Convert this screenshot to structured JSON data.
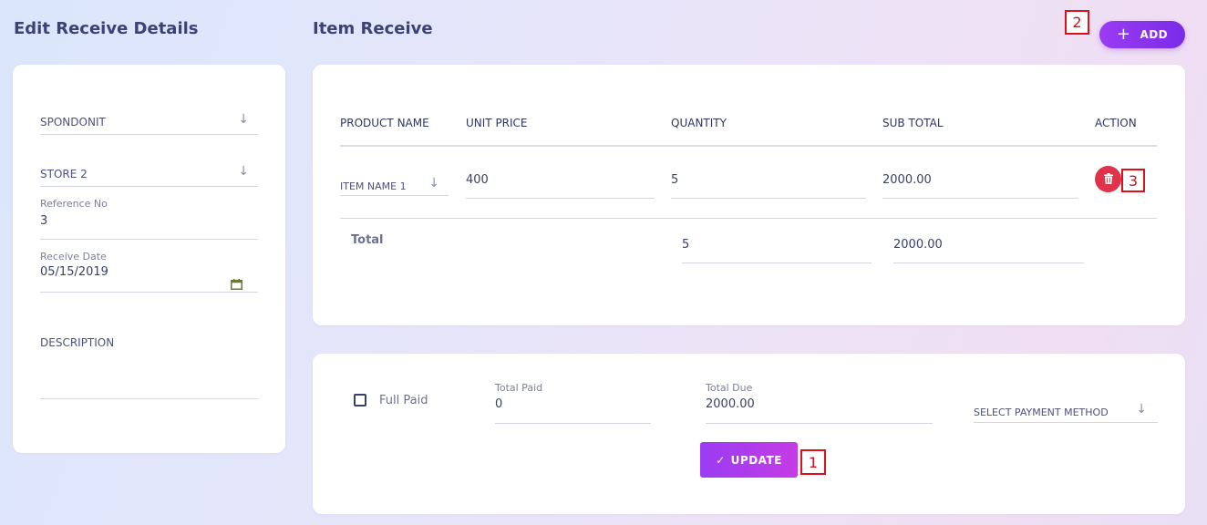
{
  "left_panel": {
    "title": "Edit Receive Details",
    "supplier_select": "SPONDONIT",
    "store_select": "STORE 2",
    "reference": {
      "label": "Reference No",
      "value": "3"
    },
    "receive_date": {
      "label": "Receive Date",
      "value": "05/15/2019"
    },
    "description": {
      "label": "DESCRIPTION",
      "value": ""
    }
  },
  "main": {
    "title": "Item Receive",
    "add_button": "ADD",
    "table": {
      "headers": [
        "PRODUCT NAME",
        "UNIT PRICE",
        "QUANTITY",
        "SUB TOTAL",
        "ACTION"
      ],
      "rows": [
        {
          "product": "ITEM NAME 1",
          "unit_price": "400",
          "quantity": "5",
          "sub_total": "2000.00"
        }
      ],
      "total": {
        "label": "Total",
        "quantity": "5",
        "sub_total": "2000.00"
      }
    }
  },
  "payment": {
    "full_paid_label": "Full Paid",
    "full_paid_checked": false,
    "total_paid": {
      "label": "Total Paid",
      "value": "0"
    },
    "total_due": {
      "label": "Total Due",
      "value": "2000.00"
    },
    "payment_method_select": "SELECT PAYMENT METHOD",
    "update_button": "UPDATE"
  },
  "annotations": {
    "box1": "1",
    "box2": "2",
    "box3": "3"
  },
  "colors": {
    "accent": "#8a35ee",
    "danger": "#e0324a",
    "annotation": "#e0101a"
  },
  "icons": {
    "arrow": "arrow-down-icon",
    "calendar": "calendar-icon",
    "trash": "trash-icon",
    "plus": "plus-icon",
    "check": "check-icon"
  }
}
